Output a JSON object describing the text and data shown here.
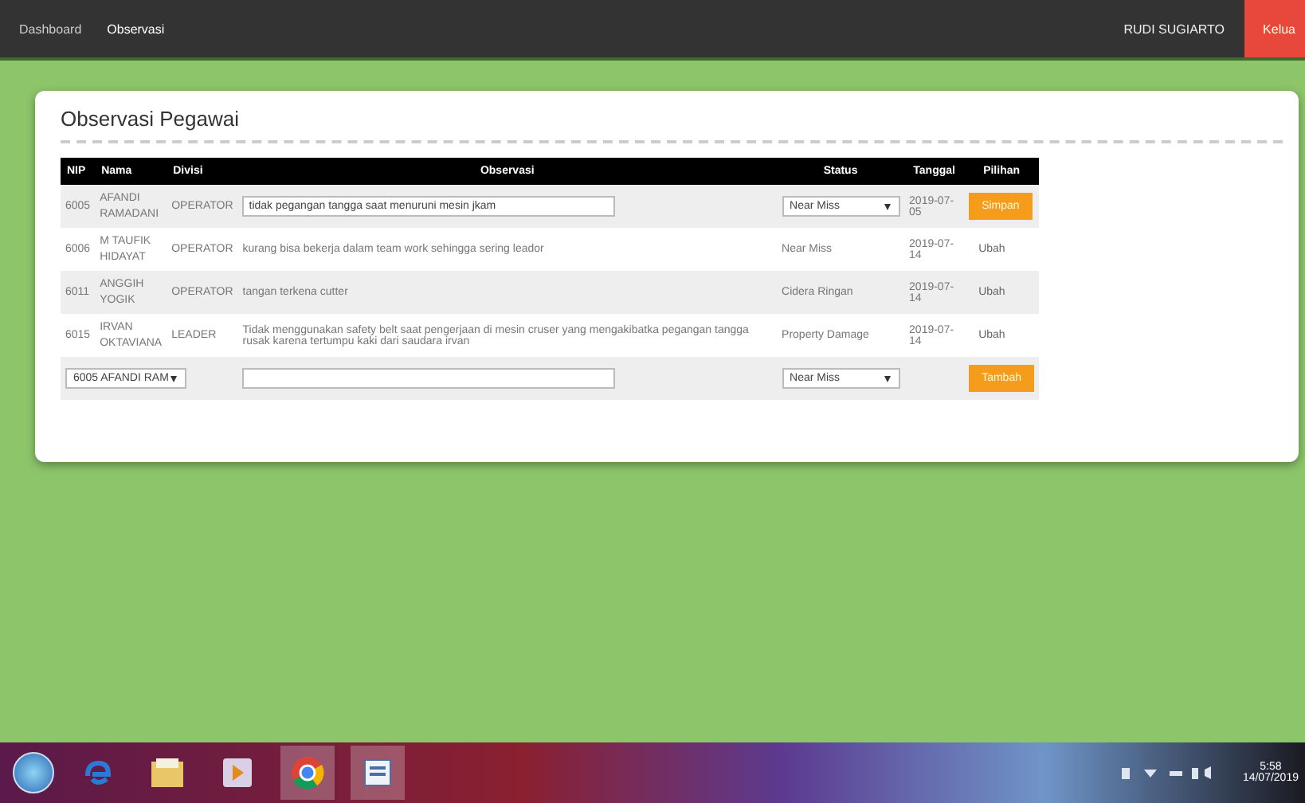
{
  "navbar": {
    "links": [
      {
        "label": "Dashboard",
        "selected": false
      },
      {
        "label": "Observasi",
        "selected": true
      }
    ],
    "user": "RUDI SUGIARTO",
    "logout": "Kelua"
  },
  "panel": {
    "title": "Observasi Pegawai"
  },
  "table": {
    "columns": [
      "NIP",
      "Nama",
      "Divisi",
      "Observasi",
      "Status",
      "Tanggal",
      "Pilihan"
    ],
    "rows": [
      {
        "kind": "edit",
        "nip": "6005",
        "name": [
          "AFANDI",
          "RAMADANI"
        ],
        "divisi": "OPERATOR",
        "observasi": "tidak pegangan tangga saat menuruni mesin jkam",
        "status": "Near Miss",
        "tanggal": "2019-07-05",
        "action": "Simpan"
      },
      {
        "kind": "view",
        "nip": "6006",
        "name": [
          "M TAUFIK",
          "HIDAYAT"
        ],
        "divisi": "OPERATOR",
        "observasi": "kurang bisa bekerja dalam team work sehingga sering leador",
        "status": "Near Miss",
        "tanggal": "2019-07-14",
        "action": "Ubah"
      },
      {
        "kind": "view",
        "nip": "6011",
        "name": [
          "ANGGIH",
          "YOGIK"
        ],
        "divisi": "OPERATOR",
        "observasi": "tangan terkena cutter",
        "status": "Cidera Ringan",
        "tanggal": "2019-07-14",
        "action": "Ubah"
      },
      {
        "kind": "view",
        "nip": "6015",
        "name": [
          "IRVAN",
          "OKTAVIANA"
        ],
        "divisi": "LEADER",
        "observasi": "Tidak menggunakan safety belt saat pengerjaan di mesin cruser yang mengakibatka pegangan tangga rusak karena tertumpu kaki dari saudara irvan",
        "status": "Property Damage",
        "tanggal": "2019-07-14",
        "action": "Ubah"
      }
    ],
    "add_row": {
      "employee": "6005  AFANDI RAM",
      "status": "Near Miss",
      "action": "Tambah"
    }
  },
  "taskbar": {
    "clock": "5:58",
    "date": "14/07/2019"
  }
}
